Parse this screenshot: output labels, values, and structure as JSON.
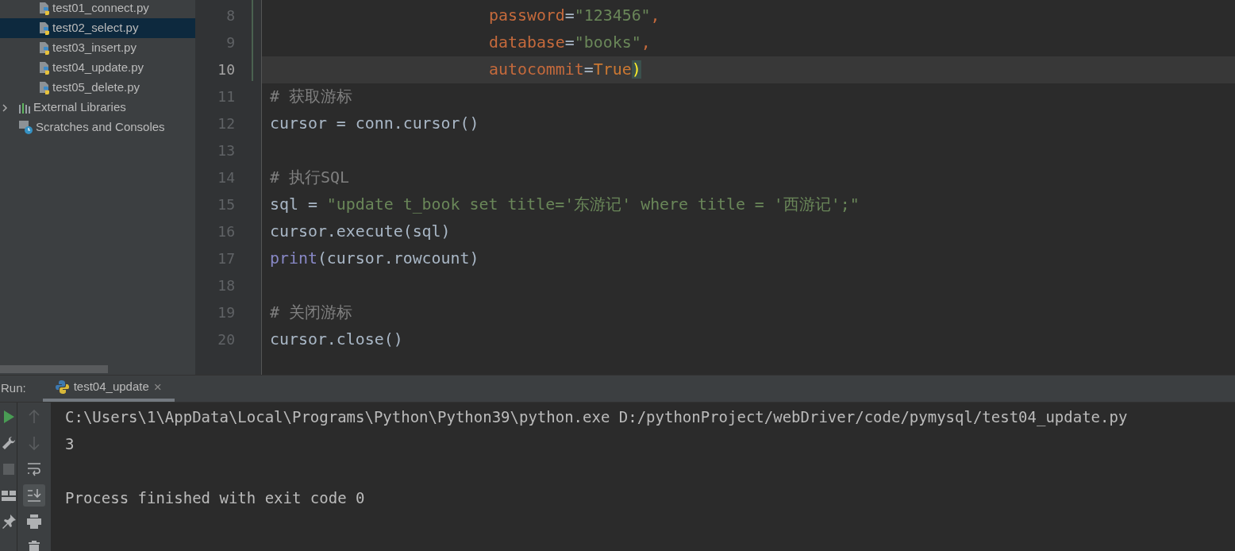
{
  "project_tree": [
    {
      "label": "test01_connect.py",
      "kind": "pyfile",
      "selected": false
    },
    {
      "label": "test02_select.py",
      "kind": "pyfile",
      "selected": true
    },
    {
      "label": "test03_insert.py",
      "kind": "pyfile",
      "selected": false
    },
    {
      "label": "test04_update.py",
      "kind": "pyfile",
      "selected": false
    },
    {
      "label": "test05_delete.py",
      "kind": "pyfile",
      "selected": false
    },
    {
      "label": "External Libraries",
      "kind": "libraries",
      "selected": false,
      "expanded": false
    },
    {
      "label": "Scratches and Consoles",
      "kind": "scratches",
      "selected": false
    }
  ],
  "editor": {
    "lines": [
      {
        "number": "8",
        "kind": "continuation",
        "current": false,
        "tokens": [
          {
            "text": "password",
            "kind": "param"
          },
          {
            "text": "=",
            "kind": "plain"
          },
          {
            "text": "\"123456\"",
            "kind": "string"
          },
          {
            "text": ",",
            "kind": "param"
          }
        ]
      },
      {
        "number": "9",
        "kind": "continuation",
        "current": false,
        "tokens": [
          {
            "text": "database",
            "kind": "param"
          },
          {
            "text": "=",
            "kind": "plain"
          },
          {
            "text": "\"books\"",
            "kind": "string"
          },
          {
            "text": ",",
            "kind": "param"
          }
        ]
      },
      {
        "number": "10",
        "kind": "continuation",
        "current": true,
        "tokens": [
          {
            "text": "autocommit",
            "kind": "param"
          },
          {
            "text": "=",
            "kind": "plain"
          },
          {
            "text": "True",
            "kind": "keyword"
          },
          {
            "text": ")",
            "kind": "brace"
          }
        ]
      },
      {
        "number": "11",
        "kind": "statement",
        "current": false,
        "tokens": [
          {
            "text": "# 获取游标",
            "kind": "comment"
          }
        ]
      },
      {
        "number": "12",
        "kind": "statement",
        "current": false,
        "tokens": [
          {
            "text": "cursor = conn.cursor()",
            "kind": "plain"
          }
        ]
      },
      {
        "number": "13",
        "kind": "statement",
        "current": false
      },
      {
        "number": "14",
        "kind": "statement",
        "current": false,
        "tokens": [
          {
            "text": "# 执行SQL",
            "kind": "comment"
          }
        ]
      },
      {
        "number": "15",
        "kind": "statement",
        "current": false,
        "tokens": [
          {
            "text": "sql = ",
            "kind": "plain"
          },
          {
            "text": "\"update t_book set title='东游记' where title = '西游记';\"",
            "kind": "string"
          }
        ]
      },
      {
        "number": "16",
        "kind": "statement",
        "current": false,
        "tokens": [
          {
            "text": "cursor.execute(sql)",
            "kind": "plain"
          }
        ]
      },
      {
        "number": "17",
        "kind": "statement",
        "current": false,
        "tokens": [
          {
            "text": "print",
            "kind": "builtin"
          },
          {
            "text": "(cursor.rowcount)",
            "kind": "plain"
          }
        ]
      },
      {
        "number": "18",
        "kind": "statement",
        "current": false
      },
      {
        "number": "19",
        "kind": "statement",
        "current": false,
        "tokens": [
          {
            "text": "# 关闭游标",
            "kind": "comment"
          }
        ]
      },
      {
        "number": "20",
        "kind": "statement",
        "current": false,
        "tokens": [
          {
            "text": "cursor.close()",
            "kind": "plain"
          }
        ]
      }
    ]
  },
  "run_panel": {
    "label": "Run:",
    "tabs": [
      {
        "label": "test04_update",
        "close": "×",
        "selected": true
      }
    ],
    "output": [
      "C:\\Users\\1\\AppData\\Local\\Programs\\Python\\Python39\\python.exe D:/pythonProject/webDriver/code/pymysql/test04_update.py",
      "3"
    ],
    "exit_message": "Process finished with exit code 0",
    "soft_wrap_on": false,
    "scroll_to_end_on": true
  }
}
